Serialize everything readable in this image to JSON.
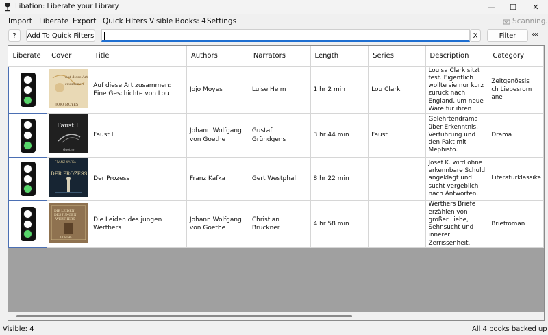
{
  "window": {
    "title": "Libation: Liberate your Library",
    "controls": {
      "minimize": "—",
      "maximize": "☐",
      "close": "✕"
    }
  },
  "menu": {
    "items": [
      "Import",
      "Liberate",
      "Export",
      "Quick Filters",
      "Visible Books: 4",
      "Settings"
    ],
    "scanning": "Scanning..."
  },
  "toolbar": {
    "help_label": "?",
    "add_quick_filter_label": "Add To Quick Filters",
    "filter_value": "",
    "clear_label": "X",
    "filter_label": "Filter",
    "collapse_label": "‹‹‹"
  },
  "grid": {
    "columns": [
      "Liberate",
      "Cover",
      "Title",
      "Authors",
      "Narrators",
      "Length",
      "Series",
      "Description",
      "Category"
    ],
    "rows": [
      {
        "liberate_status": "green",
        "cover_text": [
          "Auf diese Art",
          "zusammen",
          "JOJO MOYES"
        ],
        "title": "Auf diese Art zusammen: Eine Geschichte von Lou",
        "authors": "Jojo Moyes",
        "narrators": "Luise Helm",
        "length": "1 hr 2 min",
        "series": "Lou Clark",
        "description": "Louisa Clark sitzt fest. Eigentlich wollte sie nur kurz zurück nach England, um neue Ware für ihren",
        "category": "Zeitgenössisch Liebesromane"
      },
      {
        "liberate_status": "green",
        "cover_text": [
          "Faust I",
          "Goethe"
        ],
        "title": "Faust I",
        "authors": "Johann Wolfgang von Goethe",
        "narrators": "Gustaf Gründgens",
        "length": "3 hr 44 min",
        "series": "Faust",
        "description": "Gelehrtendrama über Erkenntnis, Verführung und den Pakt mit Mephisto.",
        "category": "Drama"
      },
      {
        "liberate_status": "green",
        "cover_text": [
          "FRANZ KAFKA",
          "DER PROZESS"
        ],
        "title": "Der Prozess",
        "authors": "Franz Kafka",
        "narrators": "Gert Westphal",
        "length": "8 hr 22 min",
        "series": "",
        "description": "Josef K. wird ohne erkennbare Schuld angeklagt und sucht vergeblich nach Antworten.",
        "category": "Literaturklassike"
      },
      {
        "liberate_status": "green",
        "cover_text": [
          "DIE LEIDEN",
          "DES JUNGEN",
          "WERTHERS",
          "GOETHE"
        ],
        "title": "Die Leiden des jungen Werthers",
        "authors": "Johann Wolfgang von Goethe",
        "narrators": "Christian Brückner",
        "length": "4 hr 58 min",
        "series": "",
        "description": "Werthers Briefe erzählen von großer Liebe, Sehnsucht und innerer Zerrissenheit.",
        "category": "Briefroman"
      }
    ]
  },
  "status": {
    "visible": "Visible: 4",
    "backup": "All 4 books backed up"
  }
}
